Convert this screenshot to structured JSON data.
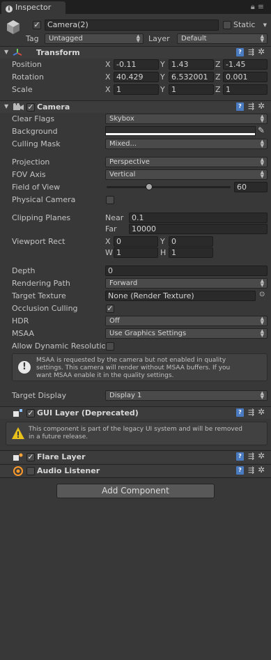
{
  "tab": {
    "title": "Inspector"
  },
  "object": {
    "name": "Camera(2)",
    "static_label": "Static",
    "tag_label": "Tag",
    "tag_value": "Untagged",
    "layer_label": "Layer",
    "layer_value": "Default"
  },
  "transform": {
    "title": "Transform",
    "position_label": "Position",
    "rotation_label": "Rotation",
    "scale_label": "Scale",
    "x": "X",
    "y": "Y",
    "z": "Z",
    "position": {
      "x": "-0.11",
      "y": "1.43",
      "z": "-1.45"
    },
    "rotation": {
      "x": "40.429",
      "y": "6.532001",
      "z": "0.001"
    },
    "scale": {
      "x": "1",
      "y": "1",
      "z": "1"
    }
  },
  "camera": {
    "title": "Camera",
    "clear_flags_label": "Clear Flags",
    "clear_flags": "Skybox",
    "background_label": "Background",
    "culling_mask_label": "Culling Mask",
    "culling_mask": "Mixed...",
    "projection_label": "Projection",
    "projection": "Perspective",
    "fov_axis_label": "FOV Axis",
    "fov_axis": "Vertical",
    "fov_label": "Field of View",
    "fov_value": "60",
    "fov_fraction": 0.34,
    "physical_label": "Physical Camera",
    "clipping_label": "Clipping Planes",
    "near_label": "Near",
    "near": "0.1",
    "far_label": "Far",
    "far": "10000",
    "viewport_label": "Viewport Rect",
    "vx_label": "X",
    "vx": "0",
    "vy_label": "Y",
    "vy": "0",
    "vw_label": "W",
    "vw": "1",
    "vh_label": "H",
    "vh": "1",
    "depth_label": "Depth",
    "depth": "0",
    "rendering_path_label": "Rendering Path",
    "rendering_path": "Forward",
    "target_texture_label": "Target Texture",
    "target_texture": "None (Render Texture)",
    "occlusion_label": "Occlusion Culling",
    "hdr_label": "HDR",
    "hdr": "Off",
    "msaa_label": "MSAA",
    "msaa": "Use Graphics Settings",
    "dynamic_res_label": "Allow Dynamic Resolutio",
    "msaa_help_1": "MSAA is requested by the camera but not enabled in quality",
    "msaa_help_2": "settings. This camera will render without MSAA buffers. If you",
    "msaa_help_3": "want MSAA enable it in the quality settings.",
    "target_display_label": "Target Display",
    "target_display": "Display 1"
  },
  "gui_layer": {
    "title": "GUI Layer (Deprecated)",
    "warn_1": "This component is part of the legacy UI system and will be removed",
    "warn_2": "in a future release."
  },
  "flare_layer": {
    "title": "Flare Layer"
  },
  "audio_listener": {
    "title": "Audio Listener"
  },
  "add_component": {
    "label": "Add Component"
  },
  "colors": {
    "background": "#383838",
    "accent": "#4a7bc0",
    "warning": "#e8c21a"
  }
}
